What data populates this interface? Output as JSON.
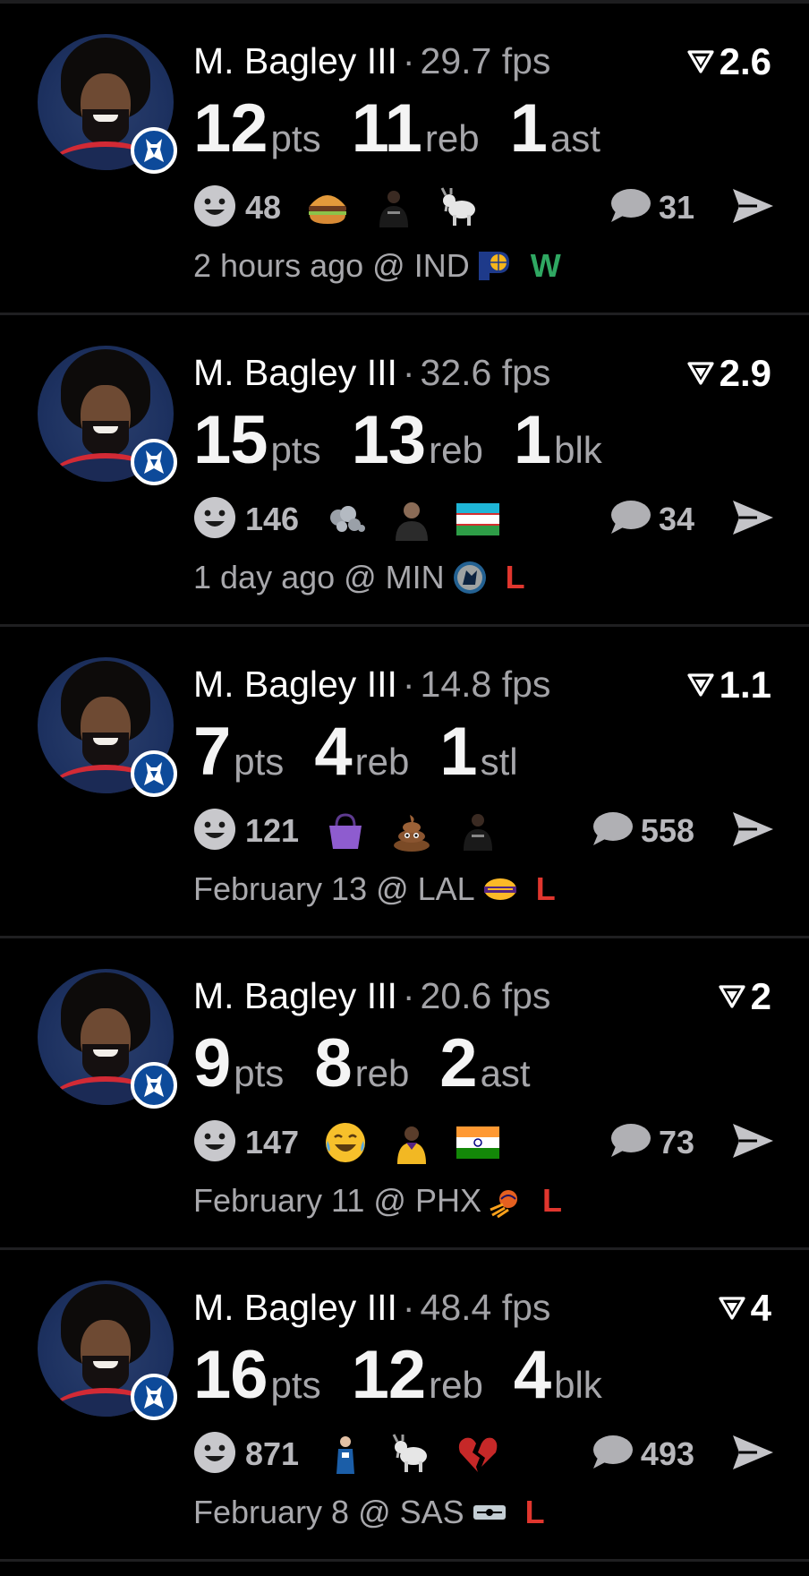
{
  "colors": {
    "background": "#000000",
    "divider": "#1f1f21",
    "win": "#2fa862",
    "loss": "#e0362e",
    "muted": "#a6a6aa"
  },
  "icons": {
    "trend": "down-triangle-icon",
    "reaction": "smiley-face-icon",
    "comment": "speech-bubble-icon",
    "share": "send-arrow-icon",
    "team_badge": "mavericks-badge-icon"
  },
  "cards": [
    {
      "player": "M. Bagley III",
      "separator": "·",
      "fps": "29.7 fps",
      "delta": "2.6",
      "stats": [
        {
          "value": "12",
          "label": "pts"
        },
        {
          "value": "11",
          "label": "reb"
        },
        {
          "value": "1",
          "label": "ast"
        }
      ],
      "reaction_count": "48",
      "emojis": [
        "burger-emoji",
        "player-nets-emoji",
        "goat-emoji"
      ],
      "comment_count": "31",
      "time": "2 hours ago @ IND",
      "opponent_logo": "pacers-logo-icon",
      "result": "W",
      "result_kind": "w"
    },
    {
      "player": "M. Bagley III",
      "separator": "·",
      "fps": "32.6 fps",
      "delta": "2.9",
      "stats": [
        {
          "value": "15",
          "label": "pts"
        },
        {
          "value": "13",
          "label": "reb"
        },
        {
          "value": "1",
          "label": "blk"
        }
      ],
      "reaction_count": "146",
      "emojis": [
        "dash-emoji",
        "person-emoji",
        "uzbekistan-flag-emoji"
      ],
      "comment_count": "34",
      "time": "1 day ago @ MIN",
      "opponent_logo": "timberwolves-logo-icon",
      "result": "L",
      "result_kind": "l"
    },
    {
      "player": "M. Bagley III",
      "separator": "·",
      "fps": "14.8 fps",
      "delta": "1.1",
      "stats": [
        {
          "value": "7",
          "label": "pts"
        },
        {
          "value": "4",
          "label": "reb"
        },
        {
          "value": "1",
          "label": "stl"
        }
      ],
      "reaction_count": "121",
      "emojis": [
        "purse-emoji",
        "poop-emoji",
        "player-nets-emoji"
      ],
      "comment_count": "558",
      "time": "February 13 @ LAL",
      "opponent_logo": "lakers-logo-icon",
      "result": "L",
      "result_kind": "l"
    },
    {
      "player": "M. Bagley III",
      "separator": "·",
      "fps": "20.6 fps",
      "delta": "2",
      "stats": [
        {
          "value": "9",
          "label": "pts"
        },
        {
          "value": "8",
          "label": "reb"
        },
        {
          "value": "2",
          "label": "ast"
        }
      ],
      "reaction_count": "147",
      "emojis": [
        "tears-of-joy-emoji",
        "player-lakers-emoji",
        "india-flag-emoji"
      ],
      "comment_count": "73",
      "time": "February 11 @ PHX",
      "opponent_logo": "suns-logo-icon",
      "result": "L",
      "result_kind": "l"
    },
    {
      "player": "M. Bagley III",
      "separator": "·",
      "fps": "48.4 fps",
      "delta": "4",
      "stats": [
        {
          "value": "16",
          "label": "pts"
        },
        {
          "value": "12",
          "label": "reb"
        },
        {
          "value": "4",
          "label": "blk"
        }
      ],
      "reaction_count": "871",
      "emojis": [
        "player-mavs-emoji",
        "goat-emoji",
        "broken-heart-emoji"
      ],
      "comment_count": "493",
      "time": "February 8 @ SAS",
      "opponent_logo": "spurs-logo-icon",
      "result": "L",
      "result_kind": "l"
    }
  ]
}
